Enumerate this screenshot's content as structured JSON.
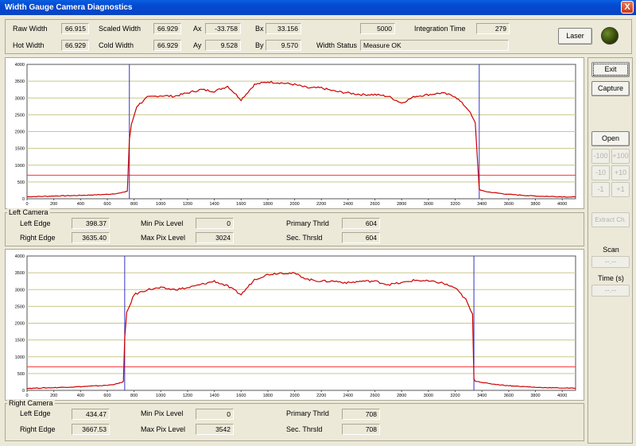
{
  "window": {
    "title": "Width Gauge Camera Diagnostics",
    "close_symbol": "X"
  },
  "top": {
    "raw_width_label": "Raw Width",
    "raw_width": "66.915",
    "hot_width_label": "Hot Width",
    "hot_width": "66.929",
    "scaled_width_label": "Scaled Width",
    "scaled_width": "66.929",
    "cold_width_label": "Cold Width",
    "cold_width": "66.929",
    "ax_label": "Ax",
    "ax": "-33.758",
    "ay_label": "Ay",
    "ay": "9.528",
    "bx_label": "Bx",
    "bx": "33.156",
    "by_label": "By",
    "by": "9.570",
    "width_status_label": "Width Status",
    "width_status": "Measure OK",
    "counter": "5000",
    "integration_label": "Integration Time",
    "integration": "279",
    "laser_label": "Laser"
  },
  "side": {
    "exit": "Exit",
    "capture": "Capture",
    "open": "Open",
    "plus100": "+100",
    "minus100": "-100",
    "plus10": "+10",
    "minus10": "-10",
    "plus1": "+1",
    "minus1": "-1",
    "extract": "Extract Ch.",
    "scan": "Scan",
    "time": "Time (s)",
    "scan_value": "--.--",
    "time_value": "--.--"
  },
  "left_camera": {
    "title": "Left Camera",
    "left_edge_label": "Left Edge",
    "left_edge": "398.37",
    "right_edge_label": "Right Edge",
    "right_edge": "3635.40",
    "min_pix_label": "Min Pix Level",
    "min_pix": "0",
    "max_pix_label": "Max Pix Level",
    "max_pix": "3024",
    "primary_label": "Primary Thrld",
    "primary": "604",
    "sec_label": "Sec. Thrsld",
    "sec": "604"
  },
  "right_camera": {
    "title": "Right Camera",
    "left_edge_label": "Left Edge",
    "left_edge": "434.47",
    "right_edge_label": "Right Edge",
    "right_edge": "3667.53",
    "min_pix_label": "Min Pix Level",
    "min_pix": "0",
    "max_pix_label": "Max Pix Level",
    "max_pix": "3542",
    "primary_label": "Primary Thrld",
    "primary": "708",
    "sec_label": "Sec. Thrsld",
    "sec": "708"
  },
  "colors": {
    "signal": "#cc0000",
    "threshold": "#ff3333",
    "edge": "#3333cc",
    "grid": "#c8c88a"
  },
  "chart_data": [
    {
      "type": "line",
      "title": "",
      "xlabel": "",
      "ylabel": "",
      "xlim": [
        0,
        4100
      ],
      "ylim": [
        0,
        4000
      ],
      "x_ticks": [
        0,
        200,
        400,
        600,
        800,
        1000,
        1200,
        1400,
        1600,
        1800,
        2000,
        2200,
        2400,
        2600,
        2800,
        3000,
        3200,
        3400,
        3600,
        3800,
        4000
      ],
      "y_ticks": [
        0,
        500,
        1000,
        1500,
        2000,
        2500,
        3000,
        3500,
        4000
      ],
      "grid": true,
      "threshold": 700,
      "edges": [
        765,
        3380
      ],
      "x": [
        0,
        200,
        400,
        600,
        700,
        750,
        765,
        780,
        820,
        900,
        1000,
        1100,
        1200,
        1300,
        1400,
        1500,
        1600,
        1700,
        1800,
        1900,
        2000,
        2100,
        2200,
        2300,
        2400,
        2500,
        2600,
        2700,
        2800,
        2900,
        3000,
        3100,
        3200,
        3300,
        3350,
        3380,
        3390,
        3450,
        3600,
        3800,
        4000,
        4100
      ],
      "y": [
        60,
        80,
        100,
        130,
        170,
        230,
        1750,
        2200,
        2750,
        3020,
        3070,
        3050,
        3150,
        3250,
        3200,
        3350,
        2950,
        3400,
        3480,
        3450,
        3400,
        3300,
        3300,
        3200,
        3150,
        3100,
        3100,
        3050,
        2850,
        3050,
        3100,
        3150,
        3050,
        2650,
        2250,
        300,
        250,
        200,
        130,
        80,
        60,
        50
      ]
    },
    {
      "type": "line",
      "title": "",
      "xlabel": "",
      "ylabel": "",
      "xlim": [
        0,
        4100
      ],
      "ylim": [
        0,
        4000
      ],
      "x_ticks": [
        0,
        200,
        400,
        600,
        800,
        1000,
        1200,
        1400,
        1600,
        1800,
        2000,
        2200,
        2400,
        2600,
        2800,
        3000,
        3200,
        3400,
        3600,
        3800,
        4000
      ],
      "y_ticks": [
        0,
        500,
        1000,
        1500,
        2000,
        2500,
        3000,
        3500,
        4000
      ],
      "grid": true,
      "threshold": 700,
      "edges": [
        730,
        3340
      ],
      "x": [
        0,
        200,
        400,
        600,
        680,
        720,
        730,
        745,
        800,
        900,
        1000,
        1100,
        1200,
        1300,
        1400,
        1500,
        1600,
        1700,
        1800,
        1900,
        2000,
        2100,
        2200,
        2300,
        2400,
        2500,
        2600,
        2700,
        2800,
        2900,
        3000,
        3100,
        3200,
        3280,
        3330,
        3340,
        3350,
        3450,
        3600,
        3800,
        4000,
        4100
      ],
      "y": [
        60,
        80,
        110,
        150,
        200,
        260,
        1550,
        2300,
        2850,
        3000,
        3050,
        3000,
        3050,
        3150,
        3250,
        3100,
        2850,
        3300,
        3450,
        3500,
        3480,
        3300,
        3250,
        3250,
        3200,
        3250,
        3250,
        3150,
        3200,
        3280,
        3250,
        3200,
        3050,
        2700,
        2250,
        350,
        280,
        200,
        140,
        90,
        70,
        60
      ]
    }
  ]
}
